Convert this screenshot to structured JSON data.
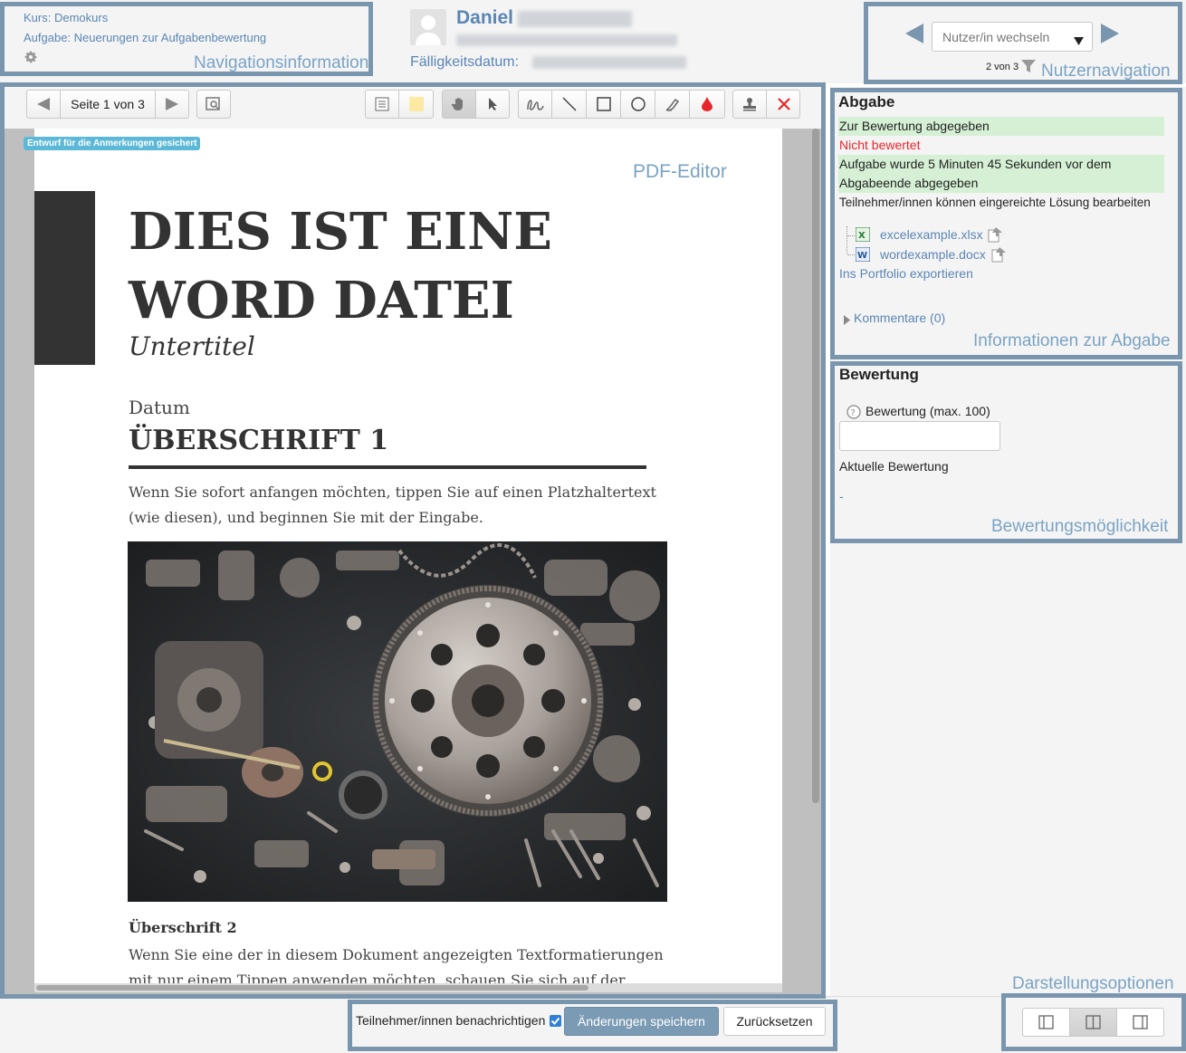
{
  "header": {
    "course_link": "Kurs: Demokurs",
    "assignment_link": "Aufgabe: Neuerungen zur Aufgabenbewertung",
    "user_first_name": "Daniel",
    "due_label": "Fälligkeitsdatum:",
    "user_switch_placeholder": "Nutzer/in wechseln",
    "user_count": "2 von 3"
  },
  "annotations": {
    "navigation_info": "Navigationsinformation",
    "user_navigation": "Nutzernavigation",
    "pdf_editor": "PDF-Editor",
    "submission_info": "Informationen zur Abgabe",
    "grading_option": "Bewertungsmöglichkeit",
    "display_options": "Darstellungsoptionen"
  },
  "toolbar": {
    "page_indicator": "Seite 1 von 3",
    "draft_badge": "Entwurf für die Anmerkungen gesichert"
  },
  "document": {
    "title_line1": "DIES IST EINE",
    "title_line2": "WORD DATEI",
    "subtitle": "Untertitel",
    "date": "Datum",
    "heading1": "ÜBERSCHRIFT 1",
    "para1_line1": "Wenn Sie sofort anfangen möchten, tippen Sie auf einen Platzhaltertext",
    "para1_line2": "(wie diesen), und beginnen Sie mit der Eingabe.",
    "heading2": "Überschrift 2",
    "para2_line1": "Wenn Sie eine der in diesem Dokument angezeigten Textformatierungen",
    "para2_line2": "mit nur einem Tippen anwenden möchten, schauen Sie sich auf der"
  },
  "submission": {
    "heading": "Abgabe",
    "status_submitted": "Zur Bewertung abgegeben",
    "status_graded": "Nicht bewertet",
    "time_line1": "Aufgabe wurde 5 Minuten 45 Sekunden vor dem",
    "time_line2": "Abgabeende abgegeben",
    "editable": "Teilnehmer/innen können eingereichte Lösung bearbeiten",
    "files": [
      {
        "name": "excelexample.xlsx",
        "icon": "excel-file-icon"
      },
      {
        "name": "wordexample.docx",
        "icon": "word-file-icon"
      }
    ],
    "export_link": "Ins Portfolio exportieren",
    "comments_link": "Kommentare (0)"
  },
  "grading": {
    "heading": "Bewertung",
    "grade_label": "Bewertung (max. 100)",
    "grade_value": "",
    "current_grade_label": "Aktuelle Bewertung",
    "current_grade_value": "-"
  },
  "footer": {
    "notify_label": "Teilnehmer/innen benachrichtigen",
    "notify_checked": true,
    "save_button": "Änderungen speichern",
    "reset_button": "Zurücksetzen"
  },
  "colors": {
    "frame": "#7a96ae",
    "annotation_text": "#7aa3c4",
    "link": "#5b86b4",
    "status_green": "#d5f0d5",
    "status_red": "#e8262a",
    "primary_button": "#7b9bb4",
    "badge": "#5bb8d6"
  }
}
